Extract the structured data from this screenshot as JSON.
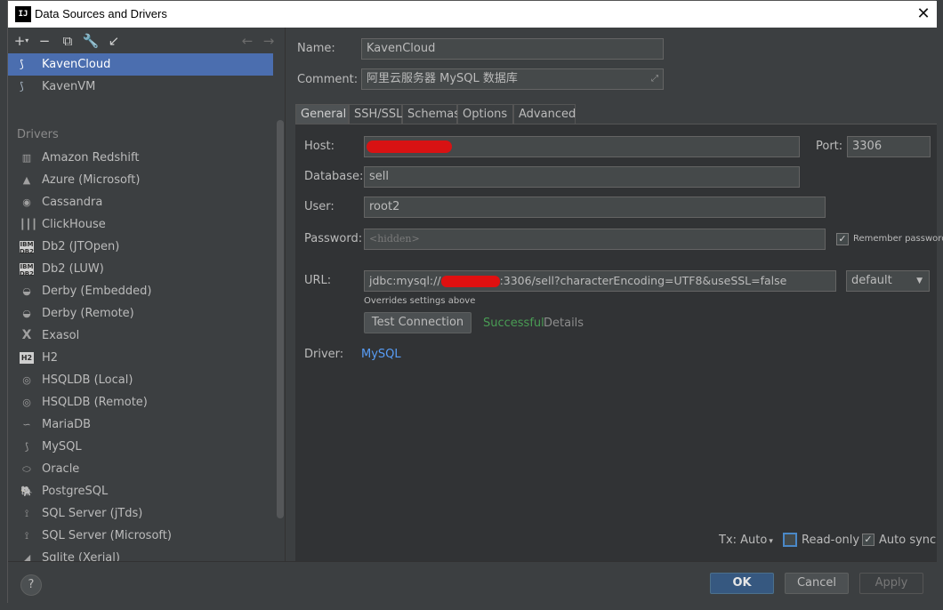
{
  "window": {
    "title": "Data Sources and Drivers",
    "app_logo": "IJ"
  },
  "toolbar": {
    "add_icon": "plus-icon",
    "remove_icon": "minus-icon",
    "duplicate_icon": "copy-icon",
    "driver_settings_icon": "wrench-icon",
    "import_icon": "import-icon",
    "back_icon": "arrow-left-icon",
    "forward_icon": "arrow-right-icon"
  },
  "data_sources": [
    {
      "label": "KavenCloud",
      "selected": true
    },
    {
      "label": "KavenVM",
      "selected": false
    }
  ],
  "drivers": {
    "header": "Drivers",
    "items": [
      {
        "label": "Amazon Redshift",
        "icon": "redshift-icon"
      },
      {
        "label": "Azure (Microsoft)",
        "icon": "azure-icon"
      },
      {
        "label": "Cassandra",
        "icon": "cassandra-icon"
      },
      {
        "label": "ClickHouse",
        "icon": "clickhouse-icon"
      },
      {
        "label": "Db2 (JTOpen)",
        "icon": "db2-icon"
      },
      {
        "label": "Db2 (LUW)",
        "icon": "db2-icon"
      },
      {
        "label": "Derby (Embedded)",
        "icon": "derby-icon"
      },
      {
        "label": "Derby (Remote)",
        "icon": "derby-icon"
      },
      {
        "label": "Exasol",
        "icon": "exasol-icon"
      },
      {
        "label": "H2",
        "icon": "h2-icon"
      },
      {
        "label": "HSQLDB (Local)",
        "icon": "hsqldb-icon"
      },
      {
        "label": "HSQLDB (Remote)",
        "icon": "hsqldb-icon"
      },
      {
        "label": "MariaDB",
        "icon": "mariadb-icon"
      },
      {
        "label": "MySQL",
        "icon": "mysql-icon"
      },
      {
        "label": "Oracle",
        "icon": "oracle-icon"
      },
      {
        "label": "PostgreSQL",
        "icon": "postgresql-icon"
      },
      {
        "label": "SQL Server (jTds)",
        "icon": "sqlserver-icon"
      },
      {
        "label": "SQL Server (Microsoft)",
        "icon": "sqlserver-icon"
      },
      {
        "label": "Sqlite (Xerial)",
        "icon": "sqlite-icon"
      }
    ]
  },
  "form": {
    "name_label": "Name:",
    "name_value": "KavenCloud",
    "comment_label": "Comment:",
    "comment_value": "阿里云服务器 MySQL 数据库",
    "tabs": [
      "General",
      "SSH/SSL",
      "Schemas",
      "Options",
      "Advanced"
    ],
    "active_tab": "General",
    "host_label": "Host:",
    "port_label": "Port:",
    "port_value": "3306",
    "database_label": "Database:",
    "database_value": "sell",
    "user_label": "User:",
    "user_value": "root2",
    "password_label": "Password:",
    "password_placeholder": "<hidden>",
    "remember_password_label": "Remember password",
    "remember_password_checked": true,
    "url_label": "URL:",
    "url_prefix": "jdbc:mysql://",
    "url_suffix": ":3306/sell?characterEncoding=UTF8&useSSL=false",
    "url_mode": "default",
    "url_hint": "Overrides settings above",
    "test_connection_label": "Test Connection",
    "test_result": "Successful",
    "details_label": "Details",
    "driver_label": "Driver:",
    "driver_value": "MySQL",
    "tx_label": "Tx: Auto",
    "readonly_label": "Read-only",
    "readonly_checked": false,
    "autosync_label": "Auto sync",
    "autosync_checked": true
  },
  "footer": {
    "help_label": "?",
    "ok_label": "OK",
    "cancel_label": "Cancel",
    "apply_label": "Apply"
  },
  "colors": {
    "selection": "#4b6eaf",
    "success": "#499c54",
    "link": "#589df6",
    "primary_button": "#365880"
  }
}
